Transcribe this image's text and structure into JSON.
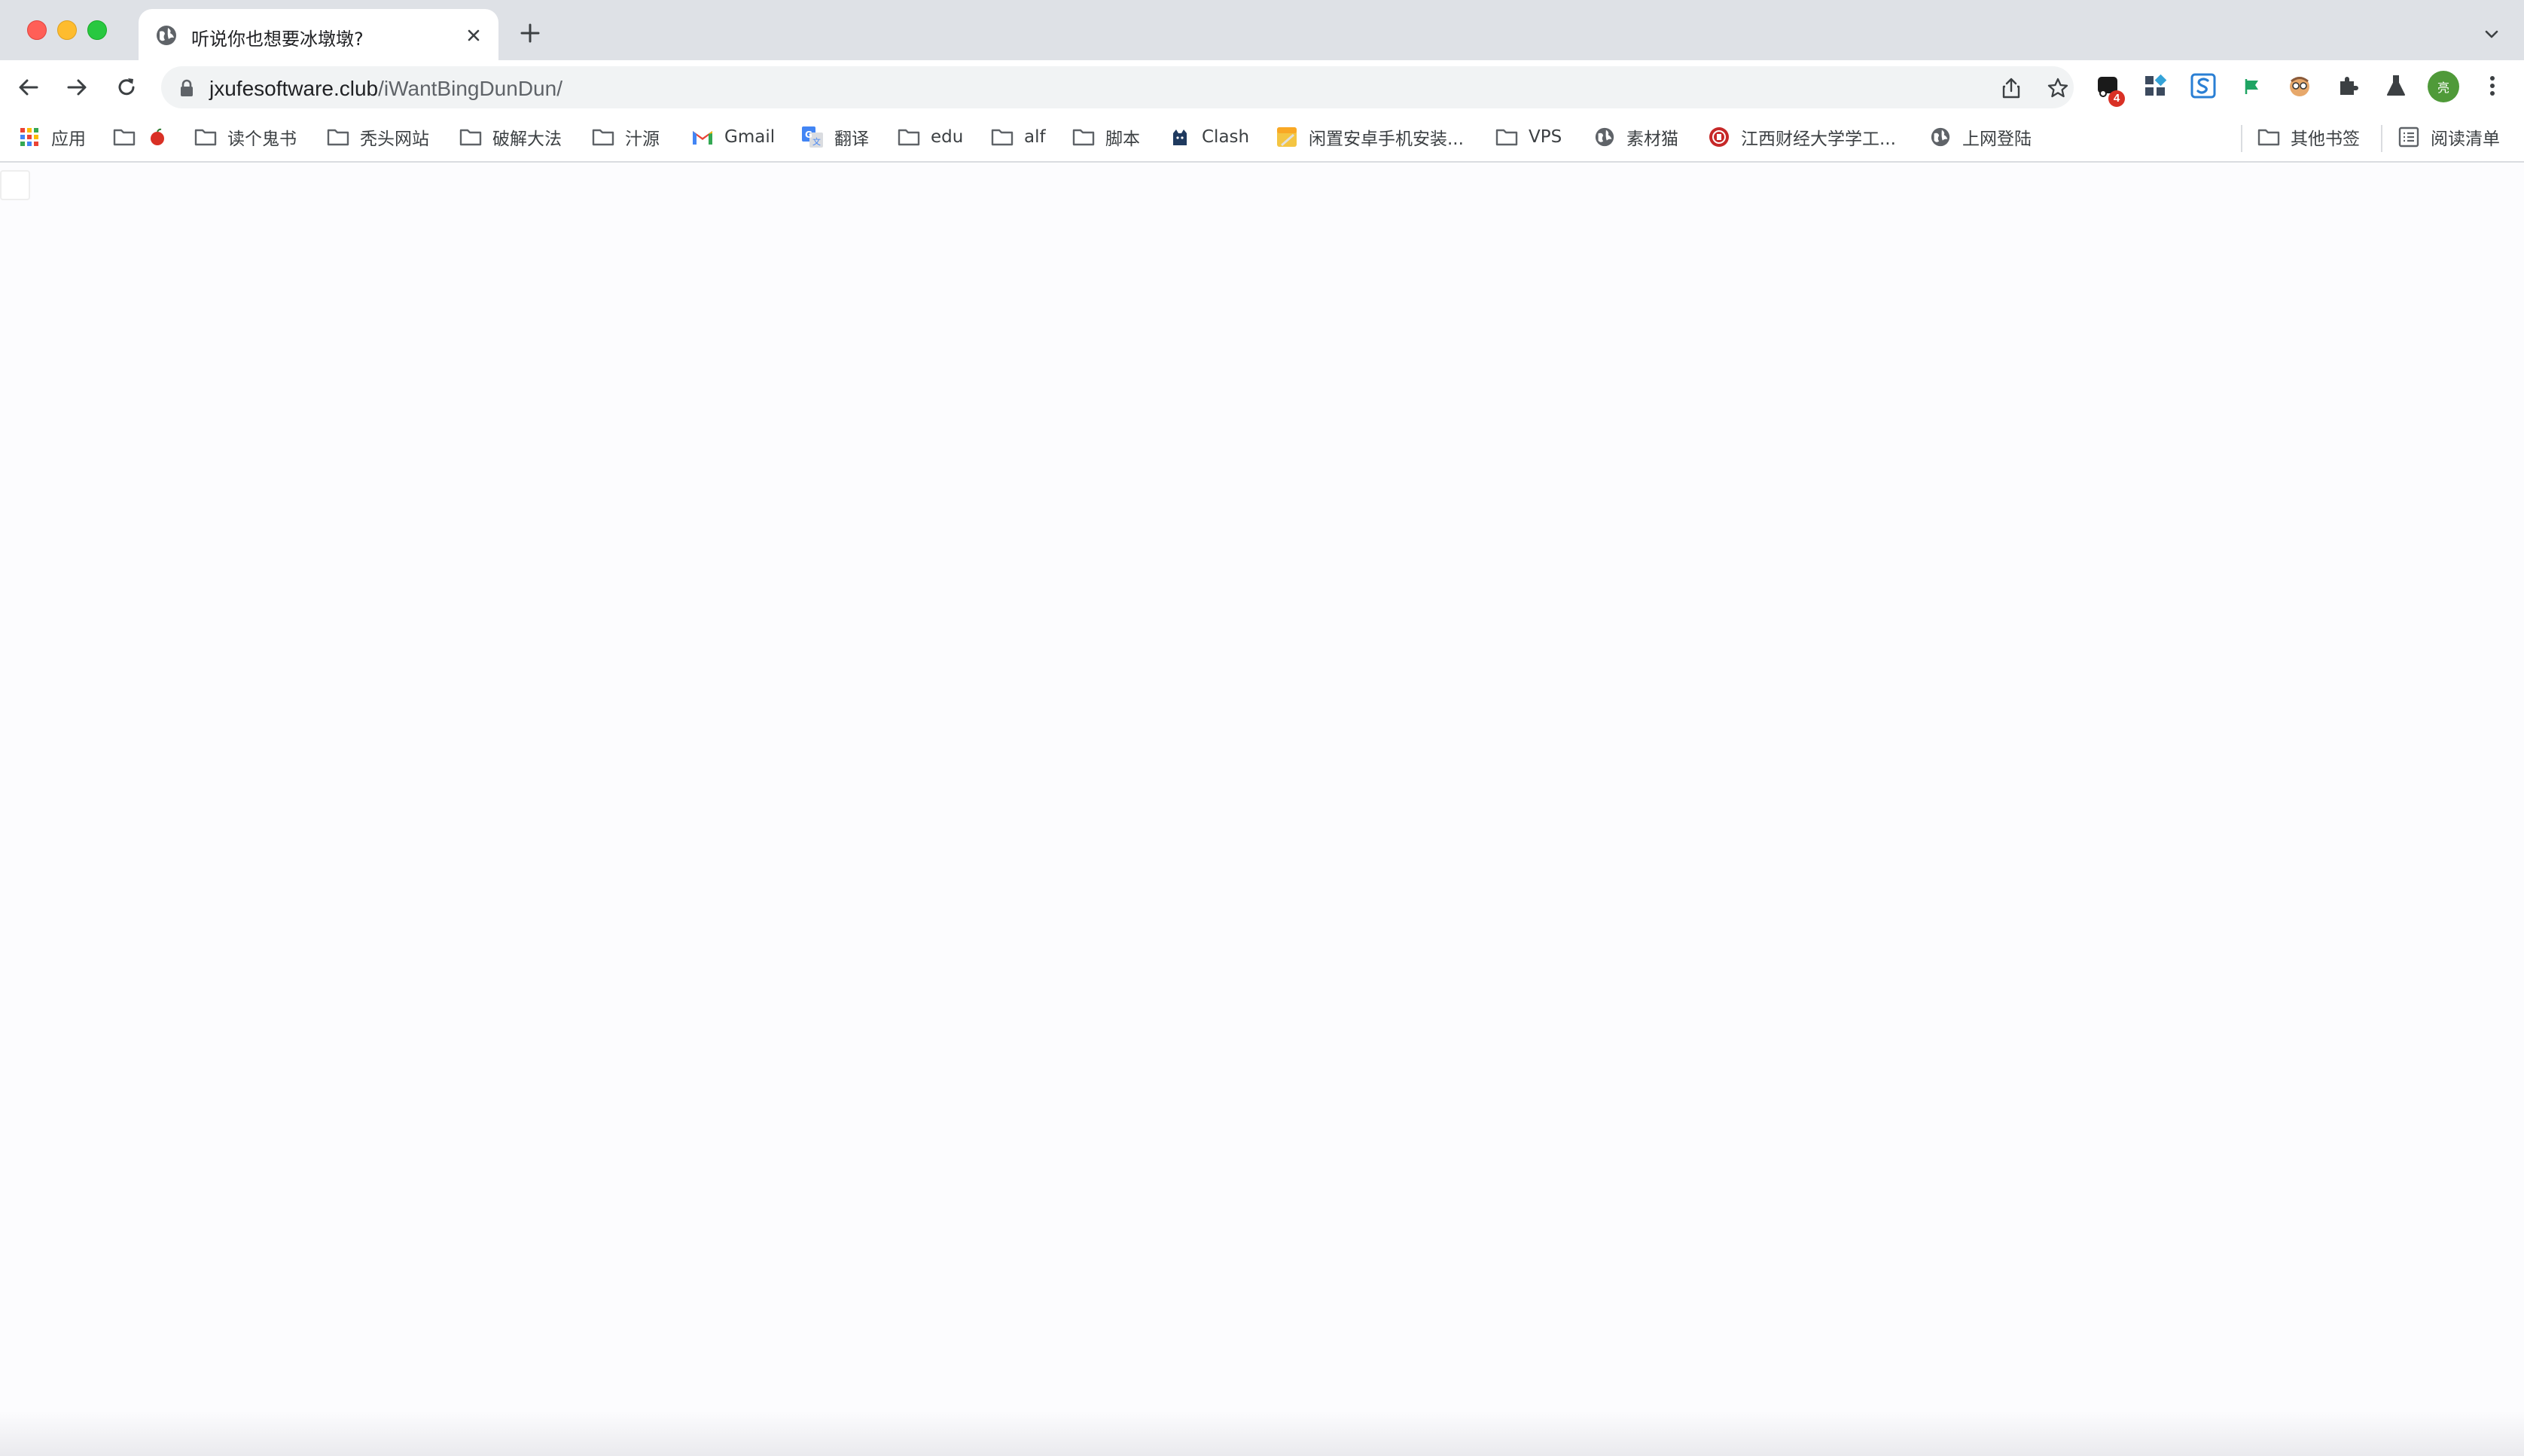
{
  "window": {
    "controls": [
      "close",
      "minimize",
      "maximize"
    ]
  },
  "tab": {
    "title": "听说你也想要冰墩墩?",
    "favicon": "globe-icon"
  },
  "toolbar": {
    "url_host": "jxufesoftware.club",
    "url_path": "/iWantBingDunDun/",
    "extension_badge": "4",
    "avatar_text": "亮"
  },
  "bookmarks": {
    "items": [
      {
        "label": "应用",
        "icon": "apps-grid-icon"
      },
      {
        "label": "",
        "icon": "folder-icon",
        "extra": "apple-icon"
      },
      {
        "label": "读个鬼书",
        "icon": "folder-icon"
      },
      {
        "label": "秃头网站",
        "icon": "folder-icon"
      },
      {
        "label": "破解大法",
        "icon": "folder-icon"
      },
      {
        "label": "汁源",
        "icon": "folder-icon"
      },
      {
        "label": "Gmail",
        "icon": "gmail-icon"
      },
      {
        "label": "翻译",
        "icon": "translate-icon"
      },
      {
        "label": "edu",
        "icon": "folder-icon"
      },
      {
        "label": "alf",
        "icon": "folder-icon"
      },
      {
        "label": "脚本",
        "icon": "folder-icon"
      },
      {
        "label": "Clash",
        "icon": "clash-cat-icon"
      },
      {
        "label": "闲置安卓手机安装...",
        "icon": "note-icon"
      },
      {
        "label": "VPS",
        "icon": "folder-icon"
      },
      {
        "label": "素材猫",
        "icon": "globe-icon"
      },
      {
        "label": "江西财经大学学工...",
        "icon": "university-seal-icon"
      },
      {
        "label": "上网登陆",
        "icon": "globe-icon"
      }
    ],
    "other_bookmarks": "其他书签",
    "reading_list": "阅读清单"
  },
  "colors": {
    "tabstrip": "#dee1e6",
    "omnibox": "#f1f3f4",
    "avatar": "#4f9a39",
    "badge": "#d93025"
  }
}
